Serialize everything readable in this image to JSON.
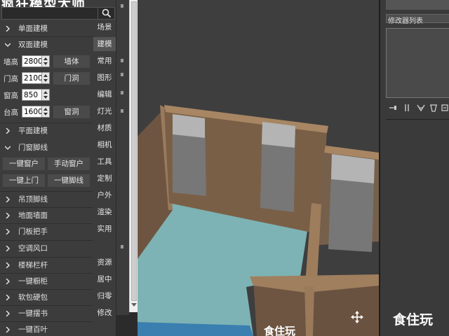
{
  "panel": {
    "title": "疯狂模型大师",
    "search_icon": "search-icon",
    "sections": [
      {
        "label": "单面建模",
        "expanded": false
      },
      {
        "label": "双面建模",
        "expanded": true
      },
      {
        "label": "平面建模",
        "expanded": false
      },
      {
        "label": "门窗脚线",
        "expanded": true
      },
      {
        "label": "吊顶脚线",
        "expanded": false
      },
      {
        "label": "地面墙面",
        "expanded": false
      },
      {
        "label": "门板把手",
        "expanded": false
      },
      {
        "label": "空调风口",
        "expanded": false
      },
      {
        "label": "楼梯栏杆",
        "expanded": false
      },
      {
        "label": "一键橱柜",
        "expanded": false
      },
      {
        "label": "软包硬包",
        "expanded": false
      },
      {
        "label": "一键摆书",
        "expanded": false
      },
      {
        "label": "一键百叶",
        "expanded": false
      }
    ],
    "params": [
      {
        "label": "墙高",
        "value": "2800",
        "button": "墙体"
      },
      {
        "label": "门高",
        "value": "2100",
        "button": "门洞"
      },
      {
        "label": "窗高",
        "value": "850",
        "button": ""
      },
      {
        "label": "台高",
        "value": "1600",
        "button": "窗洞"
      }
    ],
    "door_buttons": [
      "一键窗户",
      "手动窗户",
      "一键上门",
      "一键脚线"
    ]
  },
  "tabs": [
    "场景",
    "建模",
    "常用",
    "图形",
    "编辑",
    "灯光",
    "材质",
    "相机",
    "工具",
    "定制",
    "户外",
    "渲染",
    "实用",
    "资源",
    "居中",
    "归零",
    "修改"
  ],
  "active_tab": "建模",
  "right_panel": {
    "modifier_list_label": "修改器列表",
    "tool_icons": [
      "pin-stack-icon",
      "show-end-result-icon",
      "make-unique-icon",
      "remove-modifier-icon",
      "configure-icon"
    ]
  },
  "watermarks": {
    "viewport": "食住玩",
    "right": "食住玩"
  },
  "colors": {
    "panel_bg": "#3c3c3c",
    "viewport_bg": "#3e3e3e",
    "wall": "#7a5f47",
    "wall_top": "#a07f5e",
    "floor": "#7fb5b6",
    "window": "#8a8a8a"
  }
}
